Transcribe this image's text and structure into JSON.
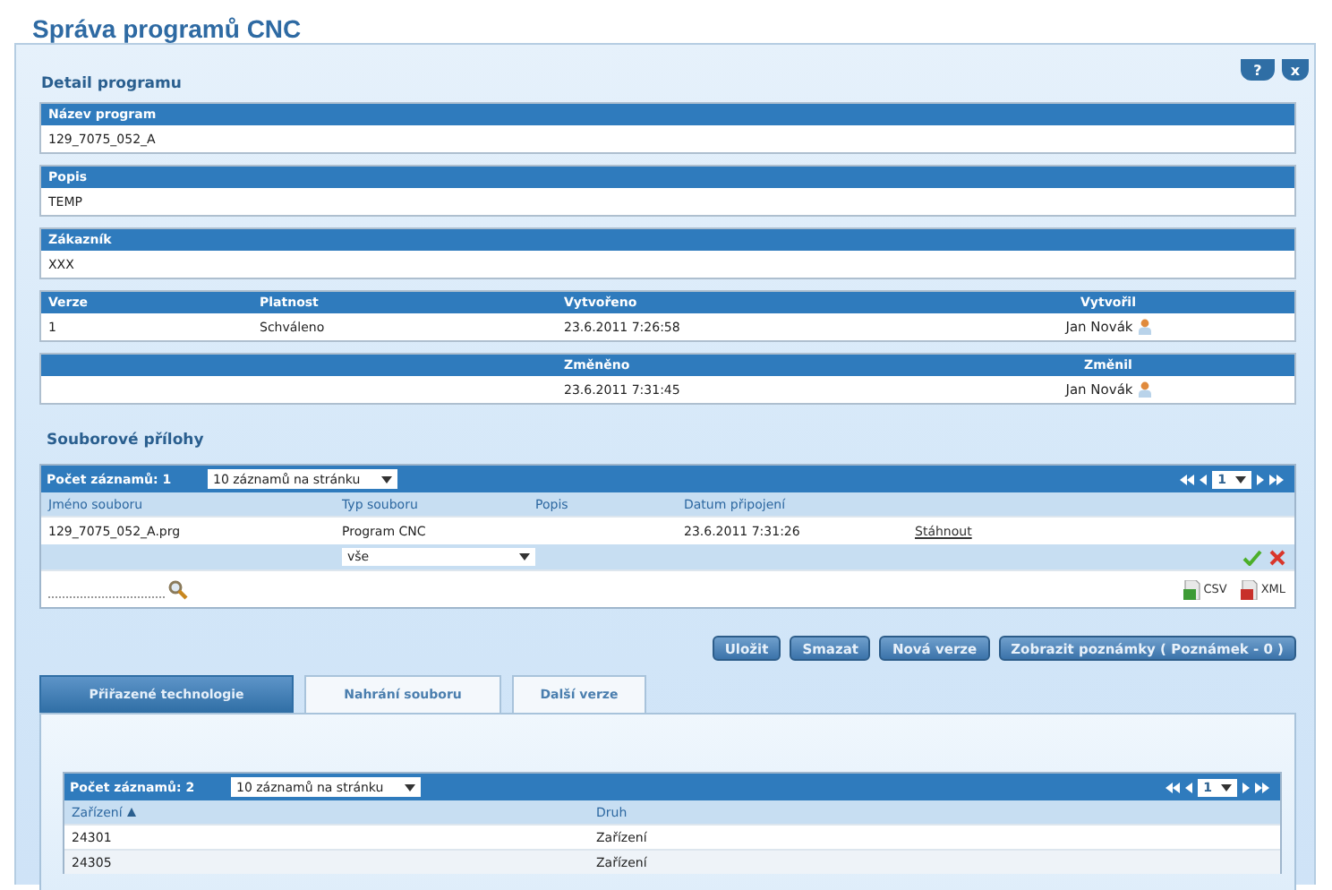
{
  "title": "Správa programů CNC",
  "window_buttons": [
    {
      "kind": "help",
      "label": "?"
    },
    {
      "kind": "close",
      "label": "x"
    }
  ],
  "detail": {
    "heading": "Detail programu",
    "fields": [
      {
        "label": "Název program",
        "value": "129_7075_052_A"
      },
      {
        "label": "Popis",
        "value": "TEMP"
      },
      {
        "label": "Zákazník",
        "value": "XXX"
      }
    ],
    "info_rows": [
      {
        "columns": [
          {
            "kind": "text",
            "label": "Verze",
            "value": "1"
          },
          {
            "kind": "text",
            "label": "Platnost",
            "value": "Schváleno"
          },
          {
            "kind": "text",
            "label": "Vytvořeno",
            "value": "23.6.2011 7:26:58"
          },
          {
            "kind": "user",
            "label": "Vytvořil",
            "value": "Jan Novák"
          }
        ]
      },
      {
        "columns": [
          {
            "kind": "blank"
          },
          {
            "kind": "blank"
          },
          {
            "kind": "text",
            "label": "Změněno",
            "value": "23.6.2011 7:31:45"
          },
          {
            "kind": "user",
            "label": "Změnil",
            "value": "Jan Novák"
          }
        ]
      }
    ]
  },
  "attachments": {
    "heading": "Souborové přílohy",
    "count": "Počet záznamů: 1",
    "page_size": "10 záznamů na stránku",
    "page": "1",
    "columns": [
      "Jméno souboru",
      "Typ souboru",
      "Popis",
      "Datum připojení"
    ],
    "rows": [
      {
        "cells": [
          "129_7075_052_A.prg",
          "Program CNC",
          "",
          "23.6.2011 7:31:26"
        ],
        "link": "Stáhnout"
      }
    ],
    "filter": {
      "value": "vše"
    },
    "exports": [
      {
        "kind": "csv",
        "label": "CSV"
      },
      {
        "kind": "xml",
        "label": "XML"
      }
    ]
  },
  "buttons": [
    "Uložit",
    "Smazat",
    "Nová verze",
    "Zobrazit poznámky ( Poznámek - 0 )"
  ],
  "tabs": [
    {
      "label": "Přiřazené technologie",
      "selected": true
    },
    {
      "label": "Nahrání souboru",
      "selected": false
    },
    {
      "label": "Další verze",
      "selected": false
    }
  ],
  "technologies": {
    "count": "Počet záznamů: 2",
    "page_size": "10 záznamů na stránku",
    "page": "1",
    "columns": [
      {
        "label": "Zařízení",
        "sorted_ascending": true
      },
      {
        "label": "Druh",
        "sorted_ascending": false
      }
    ],
    "rows": [
      [
        "24301",
        "Zařízení"
      ],
      [
        "24305",
        "Zařízení"
      ]
    ]
  }
}
